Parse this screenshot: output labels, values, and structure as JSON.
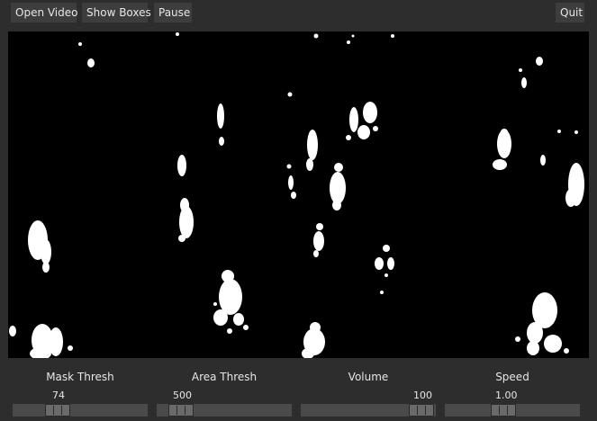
{
  "toolbar": {
    "open_label": "Open Video",
    "boxes_label": "Show Boxes",
    "pause_label": "Pause",
    "quit_label": "Quit"
  },
  "sliders": [
    {
      "label": "Mask Thresh",
      "value": "74"
    },
    {
      "label": "Area Thresh",
      "value": "500"
    },
    {
      "label": "Volume",
      "value": "100"
    },
    {
      "label": "Speed",
      "value": "1.00"
    }
  ],
  "colors": {
    "background": "#2d2d2d",
    "video_background": "#000000",
    "mask_foreground": "#ffffff",
    "button": "#3d3d3d",
    "slider_track": "#4a4a4a",
    "slider_handle": "#6a6a6a"
  }
}
